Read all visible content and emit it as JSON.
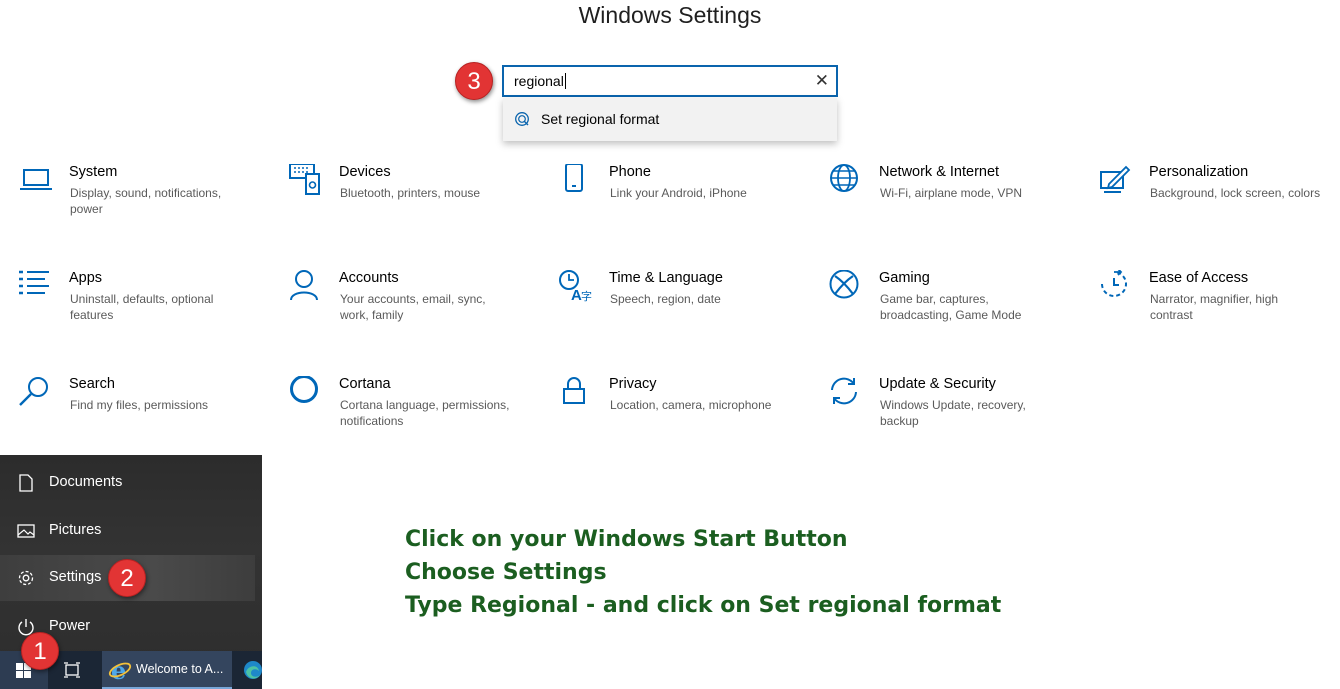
{
  "window": {
    "title": "Windows Settings"
  },
  "search": {
    "value": "regional",
    "clear_icon": "close-icon"
  },
  "suggestion": {
    "label": "Set regional format",
    "icon": "region-format-icon"
  },
  "tiles": [
    {
      "id": "system",
      "name": "System",
      "desc": "Display, sound, notifications, power",
      "icon": "laptop-icon"
    },
    {
      "id": "devices",
      "name": "Devices",
      "desc": "Bluetooth, printers, mouse",
      "icon": "devices-icon"
    },
    {
      "id": "phone",
      "name": "Phone",
      "desc": "Link your Android, iPhone",
      "icon": "phone-icon"
    },
    {
      "id": "network",
      "name": "Network & Internet",
      "desc": "Wi-Fi, airplane mode, VPN",
      "icon": "globe-icon"
    },
    {
      "id": "personalization",
      "name": "Personalization",
      "desc": "Background, lock screen, colors",
      "icon": "pen-tablet-icon"
    },
    {
      "id": "apps",
      "name": "Apps",
      "desc": "Uninstall, defaults, optional features",
      "icon": "apps-list-icon"
    },
    {
      "id": "accounts",
      "name": "Accounts",
      "desc": "Your accounts, email, sync, work, family",
      "icon": "person-icon"
    },
    {
      "id": "time-language",
      "name": "Time & Language",
      "desc": "Speech, region, date",
      "icon": "time-language-icon"
    },
    {
      "id": "gaming",
      "name": "Gaming",
      "desc": "Game bar, captures, broadcasting, Game Mode",
      "icon": "xbox-icon"
    },
    {
      "id": "ease-of-access",
      "name": "Ease of Access",
      "desc": "Narrator, magnifier, high contrast",
      "icon": "ease-of-access-icon"
    },
    {
      "id": "search",
      "name": "Search",
      "desc": "Find my files, permissions",
      "icon": "search-icon"
    },
    {
      "id": "cortana",
      "name": "Cortana",
      "desc": "Cortana language, permissions, notifications",
      "icon": "cortana-icon"
    },
    {
      "id": "privacy",
      "name": "Privacy",
      "desc": "Location, camera, microphone",
      "icon": "lock-icon"
    },
    {
      "id": "update",
      "name": "Update & Security",
      "desc": "Windows Update, recovery, backup",
      "icon": "sync-icon"
    }
  ],
  "start_menu": {
    "items": [
      {
        "label": "Documents",
        "icon": "document-icon"
      },
      {
        "label": "Pictures",
        "icon": "picture-icon"
      },
      {
        "label": "Settings",
        "icon": "gear-icon"
      },
      {
        "label": "Power",
        "icon": "power-icon"
      }
    ]
  },
  "taskbar": {
    "start_icon": "windows-logo-icon",
    "task_view_icon": "task-view-icon",
    "ie_label": "Welcome to A...",
    "ie_icon": "internet-explorer-icon",
    "edge_icon": "edge-icon"
  },
  "badges": {
    "step1": "1",
    "step2": "2",
    "step3": "3"
  },
  "instructions": [
    "Click on your Windows Start Button",
    "Choose Settings",
    "Type Regional - and click on Set regional format"
  ],
  "colors": {
    "accent": "#0a64ad",
    "badge": "#e23434",
    "instruction_text": "#1b5e20",
    "start_menu_bg": "#2c2c2c",
    "taskbar_bg": "#1b2635"
  }
}
